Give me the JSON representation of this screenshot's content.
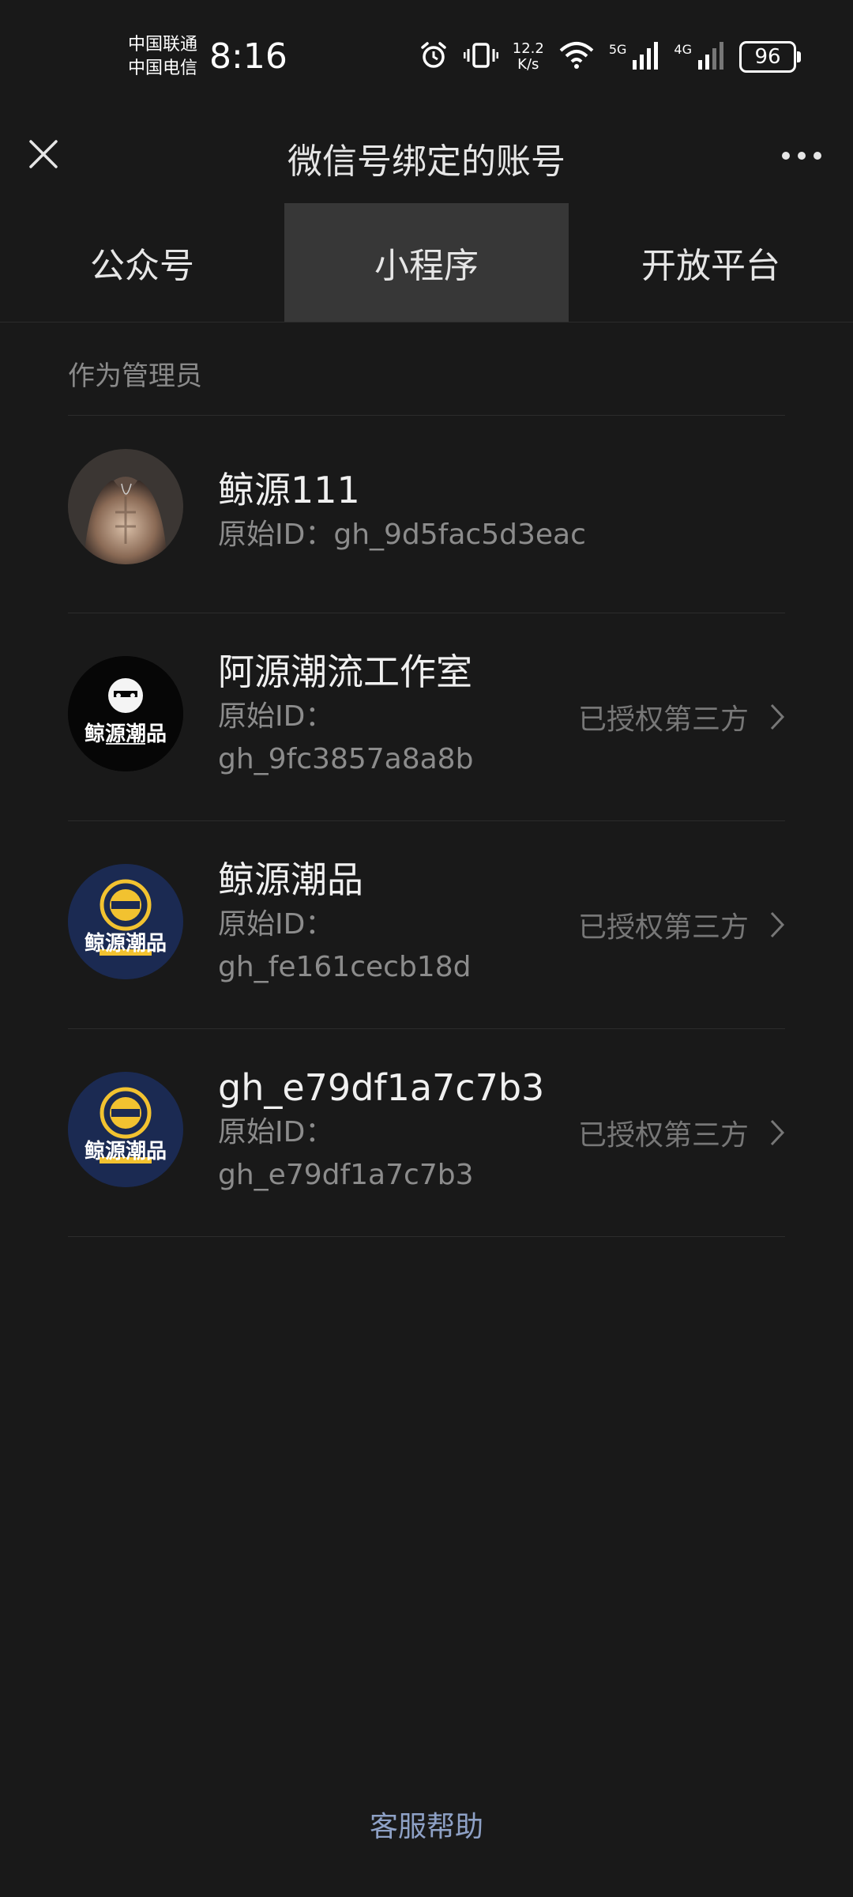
{
  "status_bar": {
    "carrier1": "中国联通",
    "carrier2": "中国电信",
    "time": "8:16",
    "net_speed_value": "12.2",
    "net_speed_unit": "K/s",
    "sig1": "5G",
    "sig2": "4G",
    "battery": "96"
  },
  "header": {
    "title": "微信号绑定的账号"
  },
  "tabs": [
    {
      "label": "公众号",
      "active": false
    },
    {
      "label": "小程序",
      "active": true
    },
    {
      "label": "开放平台",
      "active": false
    }
  ],
  "section": {
    "label": "作为管理员"
  },
  "accounts": [
    {
      "name": "鲸源111",
      "id_label": "原始ID：",
      "id_value": "gh_9d5fac5d3eac",
      "auth": "",
      "avatar": "photo-avatar"
    },
    {
      "name": "阿源潮流工作室",
      "id_label": "原始ID：",
      "id_value": "gh_9fc3857a8a8b",
      "auth": "已授权第三方",
      "avatar": "logo-black",
      "logo_text": "鲸源潮品"
    },
    {
      "name": "鲸源潮品",
      "id_label": "原始ID：",
      "id_value": "gh_fe161cecb18d",
      "auth": "已授权第三方",
      "avatar": "logo-navy",
      "logo_text": "鲸源潮品"
    },
    {
      "name": "gh_e79df1a7c7b3",
      "id_label": "原始ID：",
      "id_value": "gh_e79df1a7c7b3",
      "auth": "已授权第三方",
      "avatar": "logo-navy",
      "logo_text": "鲸源潮品"
    }
  ],
  "footer": {
    "help": "客服帮助"
  },
  "colors": {
    "background": "#191919",
    "tab_active": "#373737",
    "link": "#8ea1c6",
    "logo_navy": "#1b2a52",
    "logo_yellow": "#f2c230"
  }
}
